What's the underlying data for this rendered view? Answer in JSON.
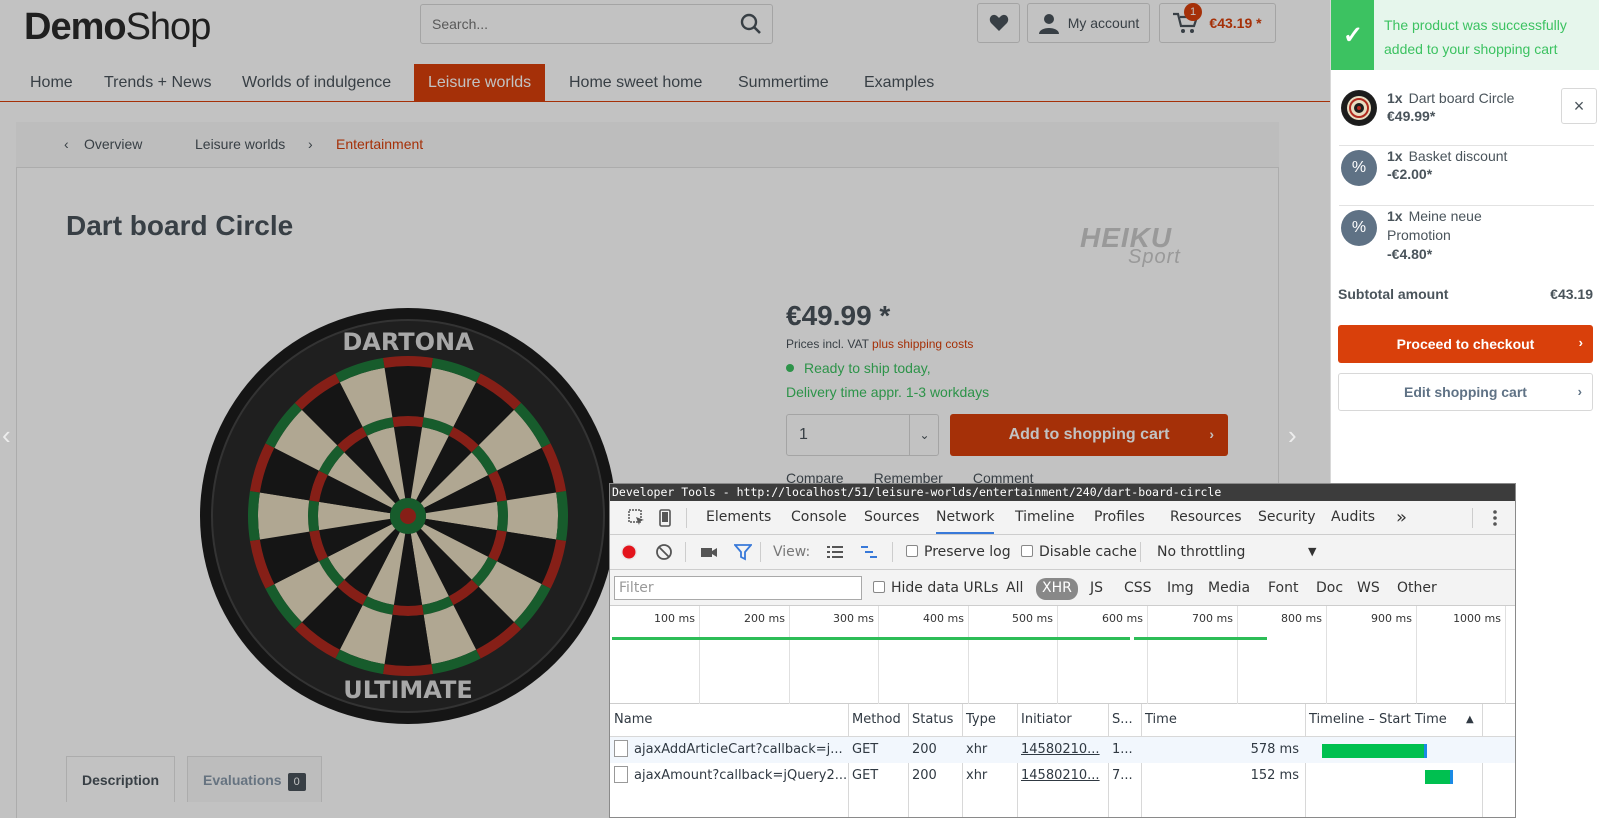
{
  "shop": {
    "logo_bold": "Demo",
    "logo_light": "Shop",
    "search_placeholder": "Search...",
    "account_label": "My account",
    "cart_total": "€43.19 *",
    "cart_count": "1",
    "nav": [
      "Home",
      "Trends + News",
      "Worlds of indulgence",
      "Leisure worlds",
      "Home sweet home",
      "Summertime",
      "Examples"
    ],
    "nav_active": "Leisure worlds",
    "breadcrumb": {
      "overview": "Overview",
      "items": [
        "Leisure worlds",
        "Entertainment"
      ]
    },
    "product": {
      "title": "Dart board Circle",
      "brand_top": "HEIKU",
      "brand_bottom": "Sport",
      "price": "€49.99 *",
      "vat_text": "Prices incl. VAT",
      "vat_link": "plus shipping costs",
      "ship_status": "Ready to ship today,",
      "delivery_time": "Delivery time appr. 1-3 workdays",
      "quantity": "1",
      "add_to_cart": "Add to shopping cart",
      "actions": [
        "Compare",
        "Remember",
        "Comment"
      ],
      "board_top_text": "DARTONA",
      "board_bottom_text": "ULTIMATE"
    },
    "tabs": {
      "description": "Description",
      "evaluations": "Evaluations",
      "evaluations_count": "0"
    }
  },
  "offcanvas": {
    "notice": "The product was successfully added to your shopping cart",
    "items": [
      {
        "qty": "1x",
        "name": "Dart board Circle",
        "price": "€49.99*",
        "icon": "dartboard-thumb"
      },
      {
        "qty": "1x",
        "name": "Basket discount",
        "price": "-€2.00*",
        "icon": "percent-icon"
      },
      {
        "qty": "1x",
        "name": "Meine neue Promotion",
        "price": "-€4.80*",
        "icon": "percent-icon"
      }
    ],
    "subtotal_label": "Subtotal amount",
    "subtotal_value": "€43.19",
    "checkout_label": "Proceed to checkout",
    "edit_cart_label": "Edit shopping cart"
  },
  "devtools": {
    "title": "Developer Tools - http://localhost/51/leisure-worlds/entertainment/240/dart-board-circle",
    "tabs": [
      "Elements",
      "Console",
      "Sources",
      "Network",
      "Timeline",
      "Profiles",
      "Resources",
      "Security",
      "Audits"
    ],
    "active_tab": "Network",
    "more_tabs": "»",
    "view_label": "View:",
    "preserve_log": "Preserve log",
    "disable_cache": "Disable cache",
    "throttling": "No throttling",
    "filter_placeholder": "Filter",
    "hide_data_urls": "Hide data URLs",
    "type_filters": [
      "All",
      "XHR",
      "JS",
      "CSS",
      "Img",
      "Media",
      "Font",
      "Doc",
      "WS",
      "Other"
    ],
    "active_type": "XHR",
    "ruler": [
      "100 ms",
      "200 ms",
      "300 ms",
      "400 ms",
      "500 ms",
      "600 ms",
      "700 ms",
      "800 ms",
      "900 ms",
      "1000 ms"
    ],
    "columns": [
      "Name",
      "Method",
      "Status",
      "Type",
      "Initiator",
      "S...",
      "Time",
      "Timeline – Start Time"
    ],
    "sort_indicator": "▲",
    "requests": [
      {
        "name": "ajaxAddArticleCart?callback=j...",
        "method": "GET",
        "status": "200",
        "type": "xhr",
        "initiator": "14580210...",
        "size": "1...",
        "time": "578 ms"
      },
      {
        "name": "ajaxAmount?callback=jQuery2...",
        "method": "GET",
        "status": "200",
        "type": "xhr",
        "initiator": "14580210...",
        "size": "7...",
        "time": "152 ms"
      }
    ]
  },
  "colors": {
    "brand": "#d9400b",
    "success": "#3cc261",
    "text": "#4a545b",
    "devtools_active": "#3879d9"
  }
}
